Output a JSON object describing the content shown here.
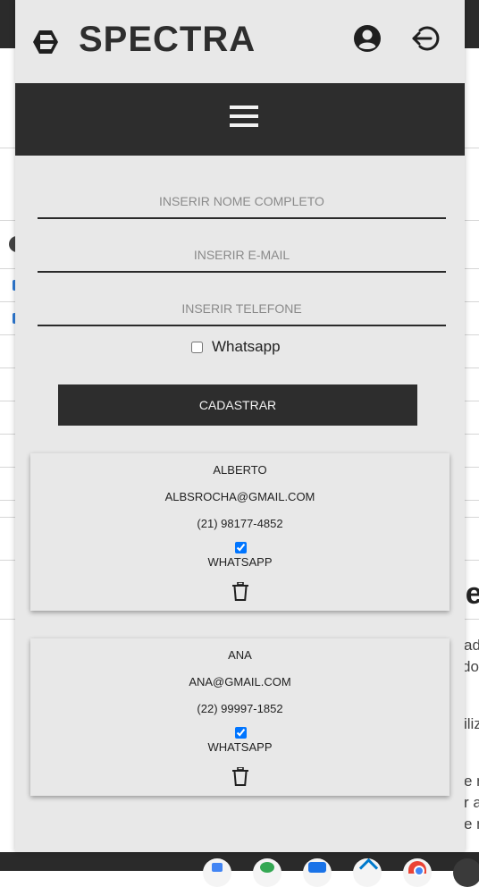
{
  "brand": {
    "name": "SPECTRA"
  },
  "form": {
    "name_placeholder": "INSERIR NOME COMPLETO",
    "email_placeholder": "INSERIR E-MAIL",
    "phone_placeholder": "INSERIR TELEFONE",
    "whatsapp_label": "Whatsapp",
    "submit_label": "CADASTRAR"
  },
  "contacts": [
    {
      "name": "ALBERTO",
      "email": "ALBSROCHA@GMAIL.COM",
      "phone": "(21) 98177-4852",
      "whatsapp": true,
      "whatsapp_label": "WHATSAPP"
    },
    {
      "name": "ANA",
      "email": "ANA@GMAIL.COM",
      "phone": "(22) 99997-1852",
      "whatsapp": true,
      "whatsapp_label": "WHATSAPP"
    }
  ],
  "background": {
    "heading_fragment": "ne",
    "text_fragments": [
      "ad",
      "do",
      "iliz",
      "e n",
      "r a",
      "e m"
    ]
  },
  "colors": {
    "panel": "#e8e8e8",
    "dark": "#2d2d2d",
    "checkbox": "#1a73e8"
  }
}
